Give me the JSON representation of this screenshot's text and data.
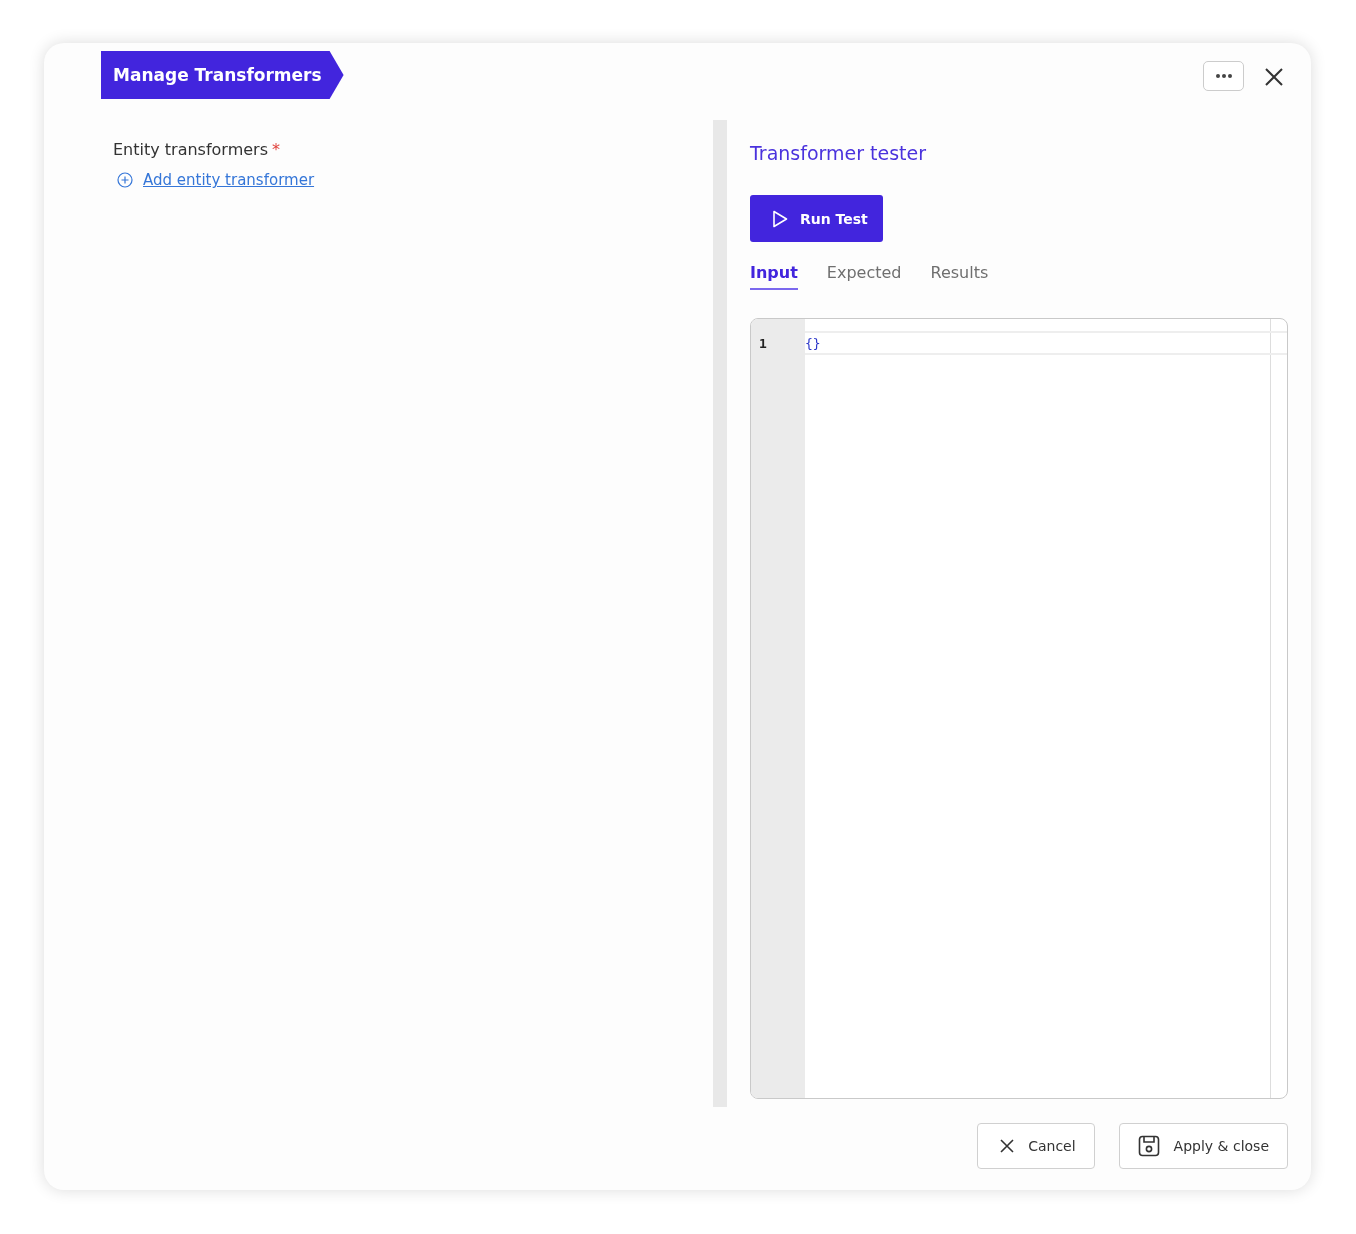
{
  "dialog": {
    "title": "Manage Transformers"
  },
  "left": {
    "label": "Entity transformers",
    "required_mark": "*",
    "add_link": "Add entity transformer"
  },
  "tester": {
    "title": "Transformer tester",
    "run_button": "Run Test",
    "tabs": [
      {
        "label": "Input",
        "selected": true
      },
      {
        "label": "Expected",
        "selected": false
      },
      {
        "label": "Results",
        "selected": false
      }
    ],
    "editor": {
      "lines": [
        {
          "number": "1",
          "code": "{}"
        }
      ]
    }
  },
  "footer": {
    "buttons": [
      {
        "label": "Cancel",
        "kind": "cancel"
      },
      {
        "label": "Apply & close",
        "kind": "apply"
      }
    ]
  }
}
